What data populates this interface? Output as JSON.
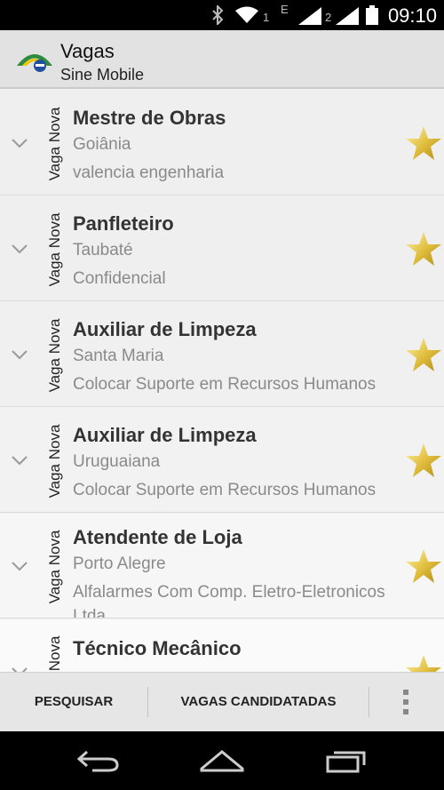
{
  "status": {
    "time": "09:10",
    "sim1": "1",
    "sim2": "2",
    "network": "E"
  },
  "app": {
    "title": "Vagas",
    "subtitle": "Sine Mobile"
  },
  "jobs": [
    {
      "tag": "Vaga Nova",
      "title": "Mestre de Obras",
      "city": "Goiânia",
      "company": "valencia engenharia"
    },
    {
      "tag": "Vaga Nova",
      "title": "Panfleteiro",
      "city": "Taubaté",
      "company": "Confidencial"
    },
    {
      "tag": "Vaga Nova",
      "title": "Auxiliar de Limpeza",
      "city": "Santa Maria",
      "company": "Colocar Suporte em Recursos Humanos"
    },
    {
      "tag": "Vaga Nova",
      "title": "Auxiliar de Limpeza",
      "city": "Uruguaiana",
      "company": "Colocar Suporte em Recursos Humanos"
    },
    {
      "tag": "Vaga Nova",
      "title": "Atendente de Loja",
      "city": "Porto Alegre",
      "company": "Alfalarmes Com Comp. Eletro-Eletronicos Ltda"
    },
    {
      "tag": "Vaga Nova",
      "title": "Técnico Mecânico",
      "city": "",
      "company": ""
    }
  ],
  "bottombar": {
    "search": "PESQUISAR",
    "applied": "VAGAS CANDIDATADAS"
  },
  "colors": {
    "star": "#e8c84a",
    "actionbar": "#e2e2e2"
  }
}
